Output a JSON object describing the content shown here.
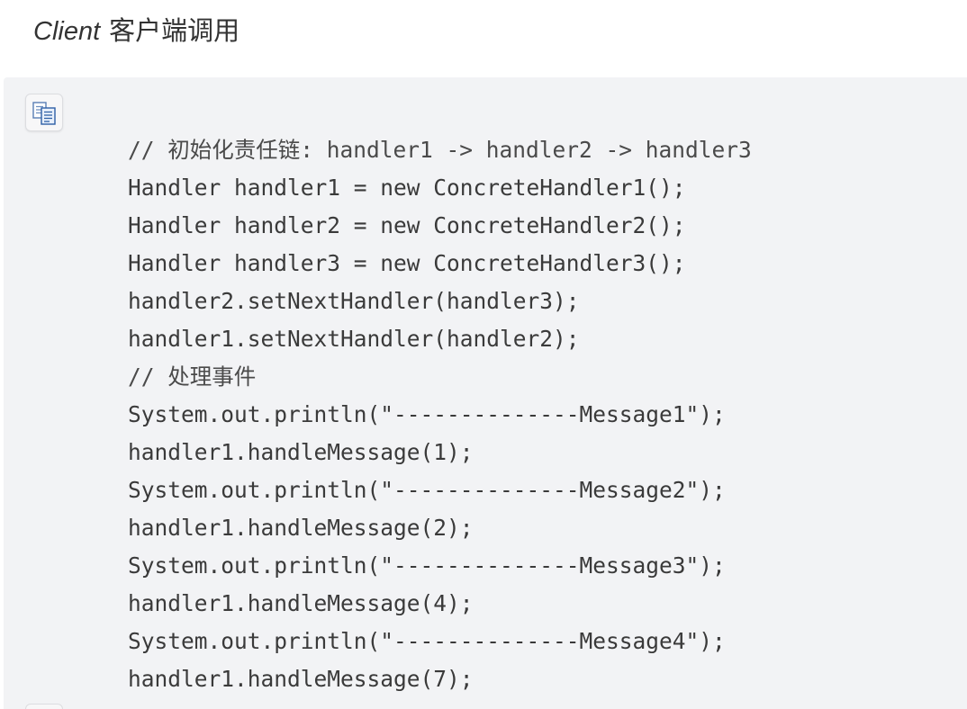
{
  "heading": {
    "latin": "Client",
    "cjk": "客户端调用"
  },
  "code_block": {
    "copy_icon": "copy-icon",
    "lines": [
      {
        "text": "// 初始化责任链: handler1 -> handler2 -> handler3",
        "kind": "comment"
      },
      {
        "text": "Handler handler1 = new ConcreteHandler1();",
        "kind": "code"
      },
      {
        "text": "Handler handler2 = new ConcreteHandler2();",
        "kind": "code"
      },
      {
        "text": "Handler handler3 = new ConcreteHandler3();",
        "kind": "code"
      },
      {
        "text": "handler2.setNextHandler(handler3);",
        "kind": "code"
      },
      {
        "text": "handler1.setNextHandler(handler2);",
        "kind": "code"
      },
      {
        "text": "// 处理事件",
        "kind": "comment"
      },
      {
        "text": "System.out.println(\"--------------Message1\");",
        "kind": "code"
      },
      {
        "text": "handler1.handleMessage(1);",
        "kind": "code"
      },
      {
        "text": "System.out.println(\"--------------Message2\");",
        "kind": "code"
      },
      {
        "text": "handler1.handleMessage(2);",
        "kind": "code"
      },
      {
        "text": "System.out.println(\"--------------Message3\");",
        "kind": "code"
      },
      {
        "text": "handler1.handleMessage(4);",
        "kind": "code"
      },
      {
        "text": "System.out.println(\"--------------Message4\");",
        "kind": "code"
      },
      {
        "text": "handler1.handleMessage(7);",
        "kind": "code"
      }
    ]
  }
}
